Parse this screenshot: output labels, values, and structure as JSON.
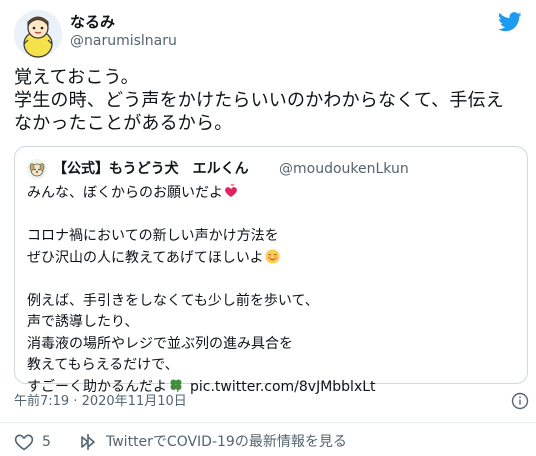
{
  "author": {
    "name": "なるみ",
    "handle": "@narumislnaru"
  },
  "tweet": {
    "lines": [
      "覚えておこう。",
      "学生の時、どう声をかけたらいいのかわからなくて、手伝え",
      "なかったことがあるから。"
    ]
  },
  "quote": {
    "name": "【公式】もうどう犬　エルくん",
    "handle": "@moudoukenLkun",
    "lines": [
      "みんな、ぼくからのお願いだよ",
      "",
      "コロナ禍においての新しい声かけ方法を",
      "ぜひ沢山の人に教えてあげてほしいよ",
      "",
      "例えば、手引きをしなくても少し前を歩いて、",
      "声で誘導したり、",
      "消毒液の場所やレジで並ぶ列の進み具合を",
      "教えてもらえるだけで、",
      "すごーく助かるんだよ"
    ],
    "link": "pic.twitter.com/8vJMbblxLt",
    "emojis": [
      "two-hearts",
      "smiling-face-blush",
      "four-leaf-clover"
    ]
  },
  "meta": {
    "timestamp": "午前7:19 · 2020年11月10日"
  },
  "actions": {
    "like_count": "5",
    "covid_link": "TwitterでCOVID-19の最新情報を見る"
  },
  "colors": {
    "brand": "#1d9bf0",
    "text": "#0f1419",
    "muted": "#536471",
    "border": "#cfd9de"
  }
}
